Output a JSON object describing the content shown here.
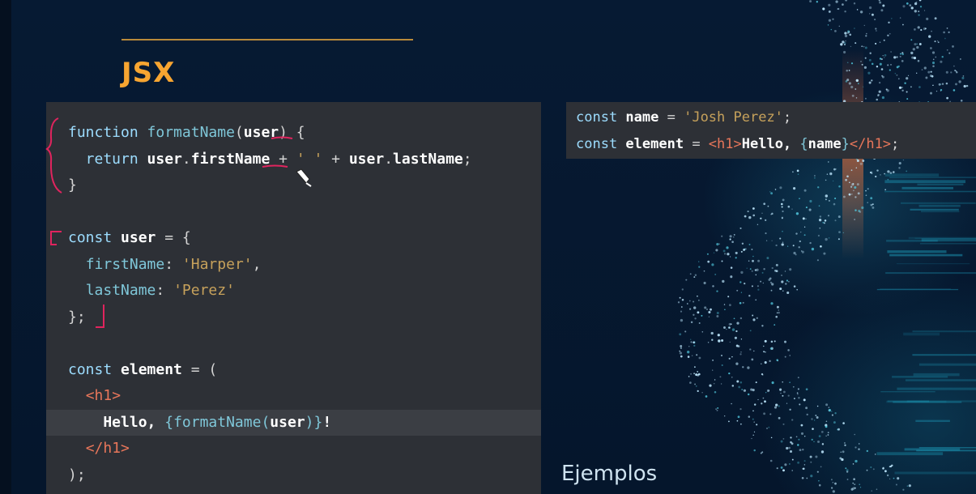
{
  "slide": {
    "title": "JSX",
    "footer_label": "Ejemplos"
  },
  "main_code": {
    "lines": [
      [
        {
          "t": "function ",
          "c": "kw"
        },
        {
          "t": "formatName",
          "c": "fn"
        },
        {
          "t": "(",
          "c": "plain"
        },
        {
          "t": "user",
          "c": "bold"
        },
        {
          "t": ") {",
          "c": "plain"
        }
      ],
      [
        {
          "t": "  return ",
          "c": "kw"
        },
        {
          "t": "user",
          "c": "bold"
        },
        {
          "t": ".",
          "c": "plain"
        },
        {
          "t": "firstName",
          "c": "bold"
        },
        {
          "t": " + ",
          "c": "plain"
        },
        {
          "t": "' '",
          "c": "str"
        },
        {
          "t": " + ",
          "c": "plain"
        },
        {
          "t": "user",
          "c": "bold"
        },
        {
          "t": ".",
          "c": "plain"
        },
        {
          "t": "lastName",
          "c": "bold"
        },
        {
          "t": ";",
          "c": "plain"
        }
      ],
      [
        {
          "t": "}",
          "c": "plain"
        }
      ],
      [],
      [
        {
          "t": "const ",
          "c": "kw"
        },
        {
          "t": "user",
          "c": "bold"
        },
        {
          "t": " = {",
          "c": "plain"
        }
      ],
      [
        {
          "t": "  ",
          "c": "plain"
        },
        {
          "t": "firstName",
          "c": "prop"
        },
        {
          "t": ": ",
          "c": "plain"
        },
        {
          "t": "'Harper'",
          "c": "str"
        },
        {
          "t": ",",
          "c": "plain"
        }
      ],
      [
        {
          "t": "  ",
          "c": "plain"
        },
        {
          "t": "lastName",
          "c": "prop"
        },
        {
          "t": ": ",
          "c": "plain"
        },
        {
          "t": "'Perez'",
          "c": "str"
        }
      ],
      [
        {
          "t": "};",
          "c": "plain"
        }
      ],
      [],
      [
        {
          "t": "const ",
          "c": "kw"
        },
        {
          "t": "element",
          "c": "bold"
        },
        {
          "t": " = (",
          "c": "plain"
        }
      ],
      [
        {
          "t": "  ",
          "c": "plain"
        },
        {
          "t": "<h1>",
          "c": "tag"
        }
      ],
      [
        {
          "t": "    Hello, ",
          "c": "bold"
        },
        {
          "t": "{",
          "c": "fn"
        },
        {
          "t": "formatName",
          "c": "fn"
        },
        {
          "t": "(",
          "c": "fn"
        },
        {
          "t": "user",
          "c": "bold"
        },
        {
          "t": ")",
          "c": "fn"
        },
        {
          "t": "}",
          "c": "fn"
        },
        {
          "t": "!",
          "c": "bold"
        }
      ],
      [
        {
          "t": "  ",
          "c": "plain"
        },
        {
          "t": "</h1>",
          "c": "tag"
        }
      ],
      [
        {
          "t": ");",
          "c": "plain"
        }
      ]
    ],
    "highlighted_line": 11
  },
  "snippet_code": {
    "lines": [
      [
        {
          "t": "const ",
          "c": "kw"
        },
        {
          "t": "name",
          "c": "bold"
        },
        {
          "t": " = ",
          "c": "plain"
        },
        {
          "t": "'Josh Perez'",
          "c": "str"
        },
        {
          "t": ";",
          "c": "plain"
        }
      ],
      [
        {
          "t": "const ",
          "c": "kw"
        },
        {
          "t": "element",
          "c": "bold"
        },
        {
          "t": " = ",
          "c": "plain"
        },
        {
          "t": "<h1>",
          "c": "tag"
        },
        {
          "t": "Hello, ",
          "c": "bold"
        },
        {
          "t": "{",
          "c": "fn"
        },
        {
          "t": "name",
          "c": "bold"
        },
        {
          "t": "}",
          "c": "fn"
        },
        {
          "t": "</h1>",
          "c": "tag"
        },
        {
          "t": ";",
          "c": "plain"
        }
      ]
    ]
  },
  "colors": {
    "title_accent": "#f7a531",
    "annotation_ink": "#e0245e",
    "code_background": "#2d3036"
  }
}
